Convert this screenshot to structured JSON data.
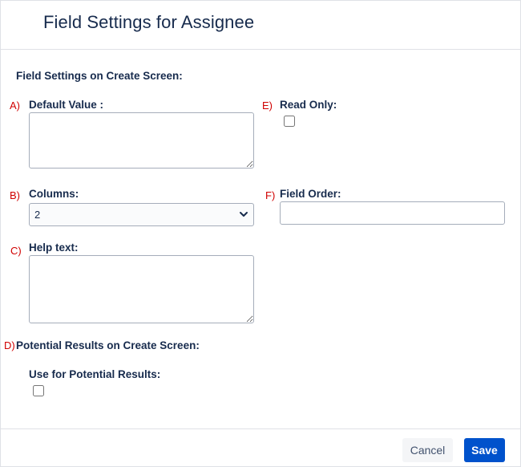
{
  "dialog": {
    "title": "Field Settings for Assignee"
  },
  "create_screen": {
    "heading": "Field Settings on Create Screen:",
    "default_value": {
      "marker": "A)",
      "label": "Default Value :",
      "value": ""
    },
    "read_only": {
      "marker": "E)",
      "label": "Read Only:",
      "checked": false
    },
    "columns": {
      "marker": "B)",
      "label": "Columns:",
      "selected": "2"
    },
    "field_order": {
      "marker": "F)",
      "label": "Field Order:",
      "value": ""
    },
    "help_text": {
      "marker": "C)",
      "label": "Help text:",
      "value": ""
    }
  },
  "potential_results": {
    "marker": "D)",
    "heading": "Potential Results on Create Screen:",
    "use_label": "Use for Potential Results:",
    "checked": false
  },
  "footer": {
    "cancel_label": "Cancel",
    "save_label": "Save"
  },
  "icons": {
    "select_chevron": "chevron-down-icon"
  },
  "colors": {
    "marker": "#d00000",
    "primary": "#0052cc",
    "text": "#172b4d"
  }
}
